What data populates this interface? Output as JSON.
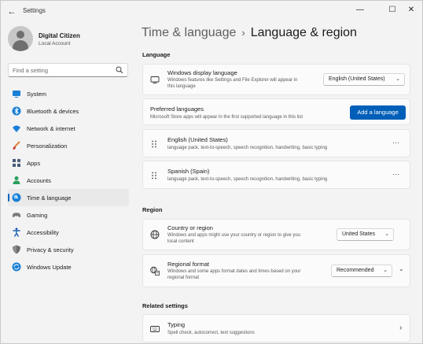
{
  "window": {
    "title": "Settings",
    "back_glyph": "←",
    "minimize_glyph": "—",
    "maximize_glyph": "☐",
    "close_glyph": "✕"
  },
  "profile": {
    "name": "Digital Citizen",
    "account_type": "Local Account"
  },
  "search": {
    "placeholder": "Find a setting",
    "icon": "search-icon"
  },
  "sidebar": {
    "items": [
      {
        "label": "System",
        "icon": "system-icon",
        "color": "#1a7fd6"
      },
      {
        "label": "Bluetooth & devices",
        "icon": "bluetooth-icon",
        "color": "#1a7fd6"
      },
      {
        "label": "Network & internet",
        "icon": "wifi-icon",
        "color": "#1a7fd6"
      },
      {
        "label": "Personalization",
        "icon": "brush-icon",
        "color": "#e3813b"
      },
      {
        "label": "Apps",
        "icon": "apps-icon",
        "color": "#4a5a78"
      },
      {
        "label": "Accounts",
        "icon": "accounts-icon",
        "color": "#2aa05a"
      },
      {
        "label": "Time & language",
        "icon": "globe-clock-icon",
        "color": "#1a7fd6",
        "active": true
      },
      {
        "label": "Gaming",
        "icon": "controller-icon",
        "color": "#7a7a7a"
      },
      {
        "label": "Accessibility",
        "icon": "accessibility-icon",
        "color": "#1a5fb4"
      },
      {
        "label": "Privacy & security",
        "icon": "shield-icon",
        "color": "#6b6b6b"
      },
      {
        "label": "Windows Update",
        "icon": "update-icon",
        "color": "#1a7fd6"
      }
    ]
  },
  "breadcrumb": {
    "parent": "Time & language",
    "separator": "›",
    "current": "Language & region"
  },
  "sections": {
    "language": "Language",
    "region": "Region",
    "related": "Related settings"
  },
  "display_language": {
    "title": "Windows display language",
    "desc_line1": "Windows features like Settings and File Explorer will appear in",
    "desc_line2": "this language",
    "value": "English (United States)",
    "chevron": "⌄"
  },
  "preferred_languages": {
    "title": "Preferred languages",
    "desc": "Microsoft Store apps will appear in the first supported language in this list",
    "button": "Add a language"
  },
  "languages": [
    {
      "name": "English (United States)",
      "features": "language pack, text-to-speech, speech recognition, handwriting, basic typing",
      "more": "···"
    },
    {
      "name": "Spanish (Spain)",
      "features": "language pack, text-to-speech, speech recognition, handwriting, basic typing",
      "more": "···"
    }
  ],
  "country": {
    "title": "Country or region",
    "desc_line1": "Windows and apps might use your country or region to give you",
    "desc_line2": "local content",
    "value": "United States",
    "chevron": "⌄"
  },
  "regional_format": {
    "title": "Regional format",
    "desc_line1": "Windows and some apps format dates and times based on your",
    "desc_line2": "regional format",
    "value": "Recommended",
    "chevron": "⌄",
    "expand": "⌄"
  },
  "typing": {
    "title": "Typing",
    "desc": "Spell check, autocorrect, text suggestions",
    "chevron": "›"
  },
  "colors": {
    "accent": "#005fb8",
    "window_bg": "#f3f3f3",
    "card_bg": "#fbfbfb"
  }
}
